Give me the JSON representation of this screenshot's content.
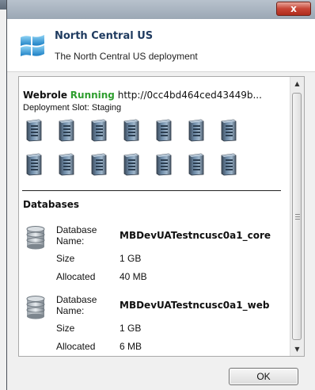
{
  "window": {
    "close_label": "x"
  },
  "header": {
    "title": "North Central US",
    "subtitle": "The North Central US deployment"
  },
  "webrole": {
    "name": "Webrole",
    "status": "Running",
    "url": "http://0cc4bd464ced43449b...",
    "slot_label": "Deployment Slot:",
    "slot_value": "Staging",
    "instance_count": 14
  },
  "databases": {
    "heading": "Databases",
    "items": [
      {
        "name_label": "Database Name:",
        "name": "MBDevUATestncusc0a1_core",
        "size_label": "Size",
        "size": "1 GB",
        "allocated_label": "Allocated",
        "allocated": "40 MB"
      },
      {
        "name_label": "Database Name:",
        "name": "MBDevUATestncusc0a1_web",
        "size_label": "Size",
        "size": "1 GB",
        "allocated_label": "Allocated",
        "allocated": "6 MB"
      }
    ]
  },
  "buttons": {
    "ok": "OK"
  },
  "colors": {
    "running": "#2e9e2e",
    "close": "#c74536"
  },
  "icons": {
    "logo": "windows-azure-logo-icon",
    "instance": "server-instance-icon",
    "database": "database-icon"
  }
}
